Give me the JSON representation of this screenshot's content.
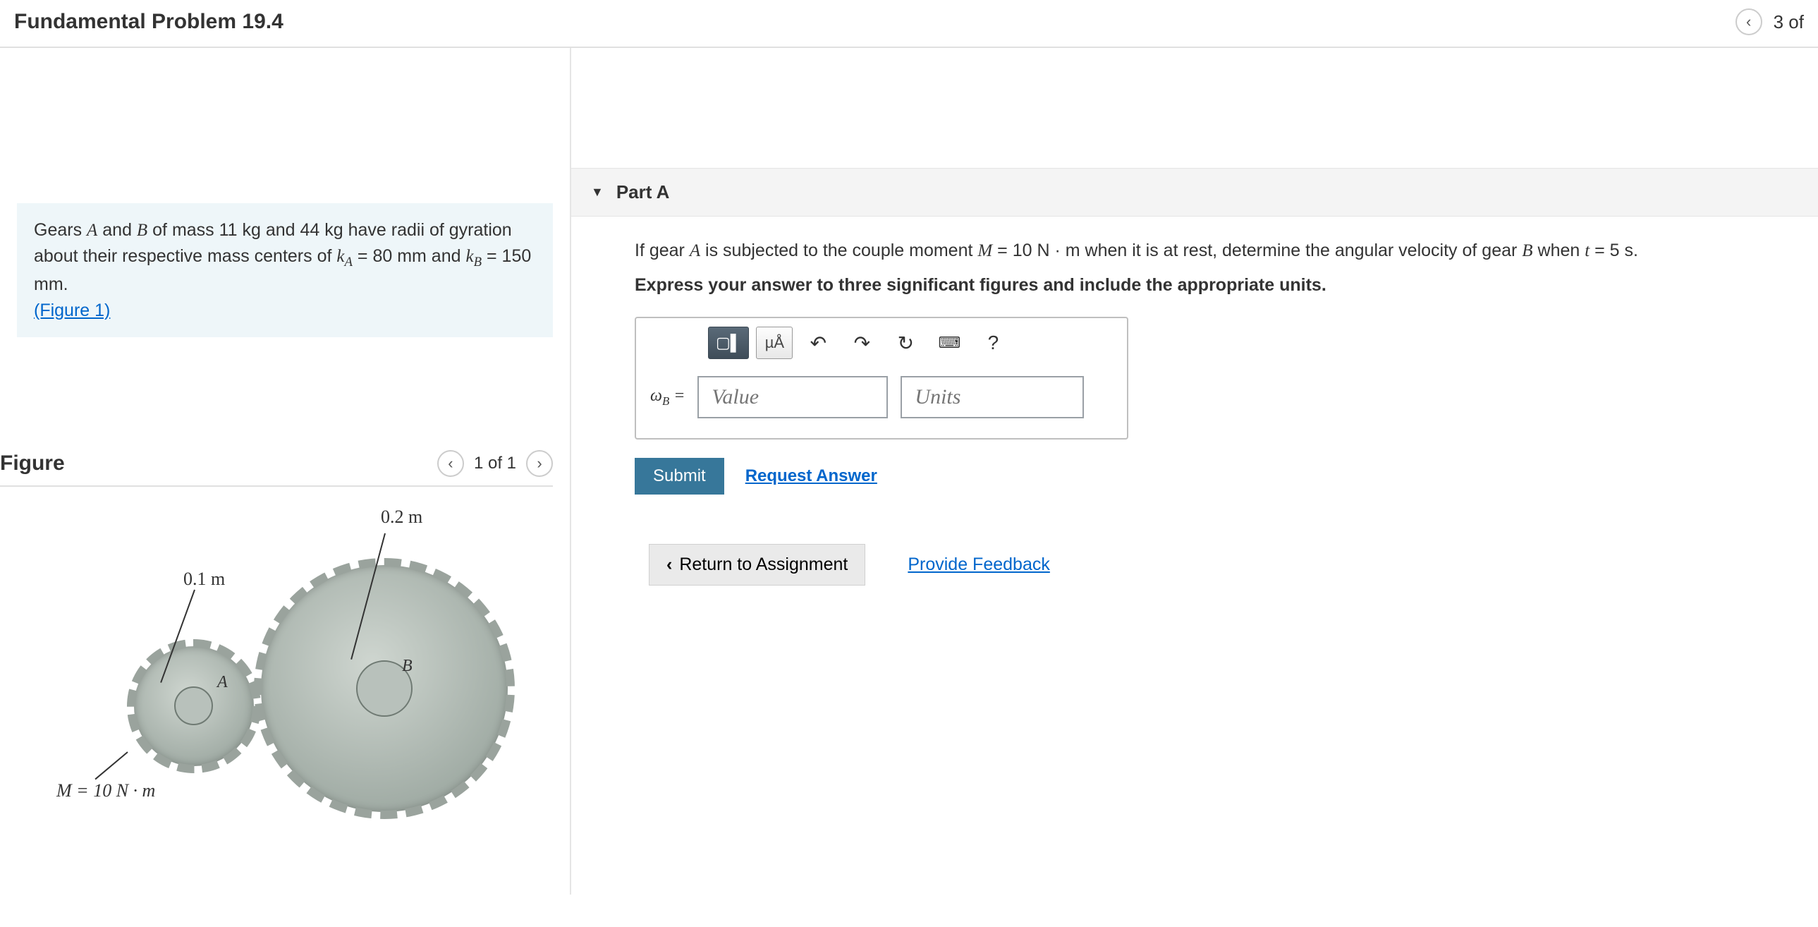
{
  "header": {
    "title": "Fundamental Problem 19.4",
    "page_indicator": "3 of"
  },
  "problem": {
    "text_1": "Gears ",
    "A": "A",
    "text_2": " and ",
    "B": "B",
    "text_3": " of mass 11 kg and 44 kg have radii of gyration about their respective mass centers of ",
    "kA": "k",
    "kA_sub": "A",
    "kA_val": " = 80 mm",
    "text_4": " and ",
    "kB": "k",
    "kB_sub": "B",
    "kB_val": " = 150 mm.",
    "figure_link": "(Figure 1)"
  },
  "figure": {
    "heading": "Figure",
    "pager": "1 of 1",
    "dim_a": "0.1 m",
    "dim_b": "0.2 m",
    "label_a": "A",
    "label_b": "B",
    "moment": "M = 10 N · m"
  },
  "partA": {
    "title": "Part A",
    "prompt_1": "If gear ",
    "A": "A",
    "prompt_2": " is subjected to the couple moment ",
    "M": "M",
    "Mval": " = 10 N · m",
    "prompt_3": " when it is at rest, determine the angular velocity of gear ",
    "B": "B",
    "prompt_4": " when ",
    "t": "t",
    "tval": " = 5 s.",
    "instruction": "Express your answer to three significant figures and include the appropriate units.",
    "toolbar": {
      "templates": "▢▌",
      "units_btn": "µÅ",
      "undo": "↶",
      "redo": "↷",
      "reset": "↻",
      "keyboard": "⌨",
      "help": "?"
    },
    "omega_prefix": "ω",
    "omega_sub": "B",
    "equals": " =",
    "value_placeholder": "Value",
    "units_placeholder": "Units",
    "submit": "Submit",
    "request_answer": "Request Answer"
  },
  "footer": {
    "return": "Return to Assignment",
    "feedback": "Provide Feedback"
  }
}
